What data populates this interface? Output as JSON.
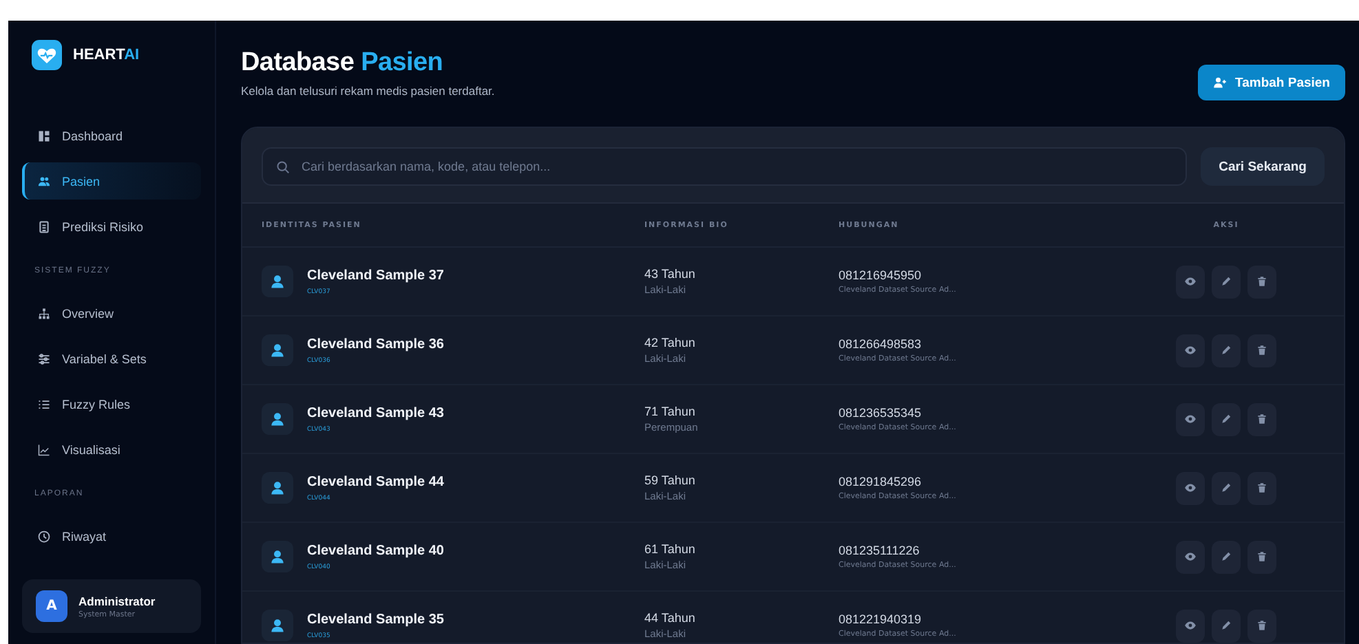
{
  "brand": {
    "name": "HEART",
    "accent": "AI"
  },
  "sidebar": {
    "items": [
      {
        "kind": "item",
        "label": "Dashboard",
        "selected": false
      },
      {
        "kind": "item",
        "label": "Pasien",
        "selected": true
      },
      {
        "kind": "item",
        "label": "Prediksi Risiko",
        "selected": false
      },
      {
        "kind": "section",
        "label": "SISTEM FUZZY"
      },
      {
        "kind": "item",
        "label": "Overview",
        "selected": false
      },
      {
        "kind": "item",
        "label": "Variabel & Sets",
        "selected": false
      },
      {
        "kind": "item",
        "label": "Fuzzy Rules",
        "selected": false
      },
      {
        "kind": "item",
        "label": "Visualisasi",
        "selected": false
      },
      {
        "kind": "section",
        "label": "LAPORAN"
      },
      {
        "kind": "item",
        "label": "Riwayat",
        "selected": false
      }
    ],
    "user": {
      "initial": "A",
      "name": "Administrator",
      "role": "System Master"
    }
  },
  "header": {
    "title": "Database",
    "title_accent": "Pasien",
    "subtitle": "Kelola dan telusuri rekam medis pasien terdaftar.",
    "add_button": "Tambah Pasien"
  },
  "search": {
    "placeholder": "Cari berdasarkan nama, kode, atau telepon...",
    "button": "Cari Sekarang"
  },
  "table": {
    "columns": [
      "IDENTITAS PASIEN",
      "INFORMASI BIO",
      "HUBUNGAN",
      "AKSI"
    ],
    "rows": [
      {
        "name": "Cleveland Sample 37",
        "code": "CLV037",
        "age": "43 Tahun",
        "gender": "Laki-Laki",
        "phone": "081216945950",
        "note": "Cleveland Dataset Source Ad..."
      },
      {
        "name": "Cleveland Sample 36",
        "code": "CLV036",
        "age": "42 Tahun",
        "gender": "Laki-Laki",
        "phone": "081266498583",
        "note": "Cleveland Dataset Source Ad..."
      },
      {
        "name": "Cleveland Sample 43",
        "code": "CLV043",
        "age": "71 Tahun",
        "gender": "Perempuan",
        "phone": "081236535345",
        "note": "Cleveland Dataset Source Ad..."
      },
      {
        "name": "Cleveland Sample 44",
        "code": "CLV044",
        "age": "59 Tahun",
        "gender": "Laki-Laki",
        "phone": "081291845296",
        "note": "Cleveland Dataset Source Ad..."
      },
      {
        "name": "Cleveland Sample 40",
        "code": "CLV040",
        "age": "61 Tahun",
        "gender": "Laki-Laki",
        "phone": "081235111226",
        "note": "Cleveland Dataset Source Ad..."
      },
      {
        "name": "Cleveland Sample 35",
        "code": "CLV035",
        "age": "44 Tahun",
        "gender": "Laki-Laki",
        "phone": "081221940319",
        "note": "Cleveland Dataset Source Ad..."
      }
    ]
  }
}
